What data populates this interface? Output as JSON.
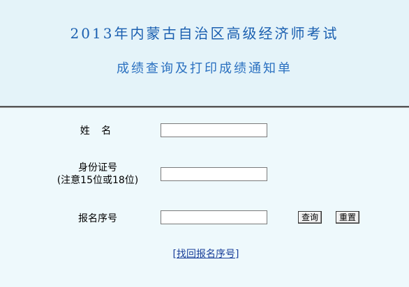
{
  "header": {
    "title_line1": "2013年内蒙古自治区高级经济师考试",
    "title_line2": "成绩查询及打印成绩通知单"
  },
  "form": {
    "name_label": "姓 名",
    "id_label": "身份证号",
    "id_hint": "(注意15位或18位)",
    "reg_label": "报名序号",
    "name_value": "",
    "id_value": "",
    "reg_value": ""
  },
  "buttons": {
    "query": "查询",
    "reset": "重置"
  },
  "links": {
    "recover": "[找回报名序号]"
  }
}
